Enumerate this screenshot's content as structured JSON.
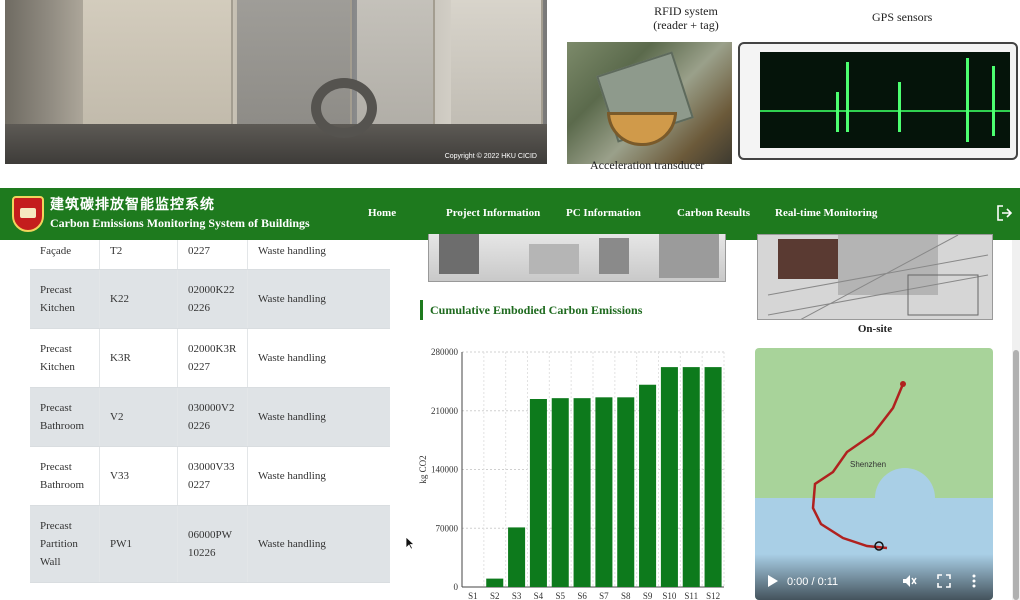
{
  "top": {
    "rfid_label_line1": "RFID system",
    "rfid_label_line2": "(reader + tag)",
    "gps_label": "GPS sensors",
    "accel_label": "Acceleration transducer",
    "photo_copyright": "Copyright © 2022 HKU CICID"
  },
  "navbar": {
    "brand_cn": "建筑碳排放智能监控系统",
    "brand_en": "Carbon Emissions Monitoring System of Buildings",
    "links": [
      "Home",
      "Project Information",
      "PC Information",
      "Carbon Results",
      "Real-time Monitoring"
    ],
    "logout_icon": "logout-icon",
    "bg_color": "#1e7a1e"
  },
  "table": {
    "rows": [
      {
        "type": "Façade",
        "code": "T2",
        "id": "0227",
        "stage": "Waste handling"
      },
      {
        "type": "Precast Kitchen",
        "code": "K22",
        "id": "02000K220226",
        "stage": "Waste handling"
      },
      {
        "type": "Precast Kitchen",
        "code": "K3R",
        "id": "02000K3R0227",
        "stage": "Waste handling"
      },
      {
        "type": "Precast Bathroom",
        "code": "V2",
        "id": "030000V20226",
        "stage": "Waste handling"
      },
      {
        "type": "Precast Bathroom",
        "code": "V33",
        "id": "03000V330227",
        "stage": "Waste handling"
      },
      {
        "type": "Precast Partition Wall",
        "code": "PW1",
        "id": "06000PW10226",
        "stage": "Waste handling"
      }
    ]
  },
  "chart_title": "Cumulative Embodied Carbon Emissions",
  "chart_data": {
    "type": "bar",
    "categories": [
      "S1",
      "S2",
      "S3",
      "S4",
      "S5",
      "S6",
      "S7",
      "S8",
      "S9",
      "S10",
      "S11",
      "S12"
    ],
    "values": [
      0,
      10000,
      71000,
      224000,
      225000,
      225000,
      226000,
      226000,
      241000,
      262000,
      262000,
      262000
    ],
    "ylabel": "kg CO2",
    "ylim": [
      0,
      280000
    ],
    "yticks": [
      0,
      70000,
      140000,
      210000,
      280000
    ],
    "bar_color": "#0d7a1c",
    "grid": true
  },
  "onsite_label": "On-site",
  "video": {
    "time": "0:00 / 0:11",
    "map_city": "Shenzhen"
  }
}
